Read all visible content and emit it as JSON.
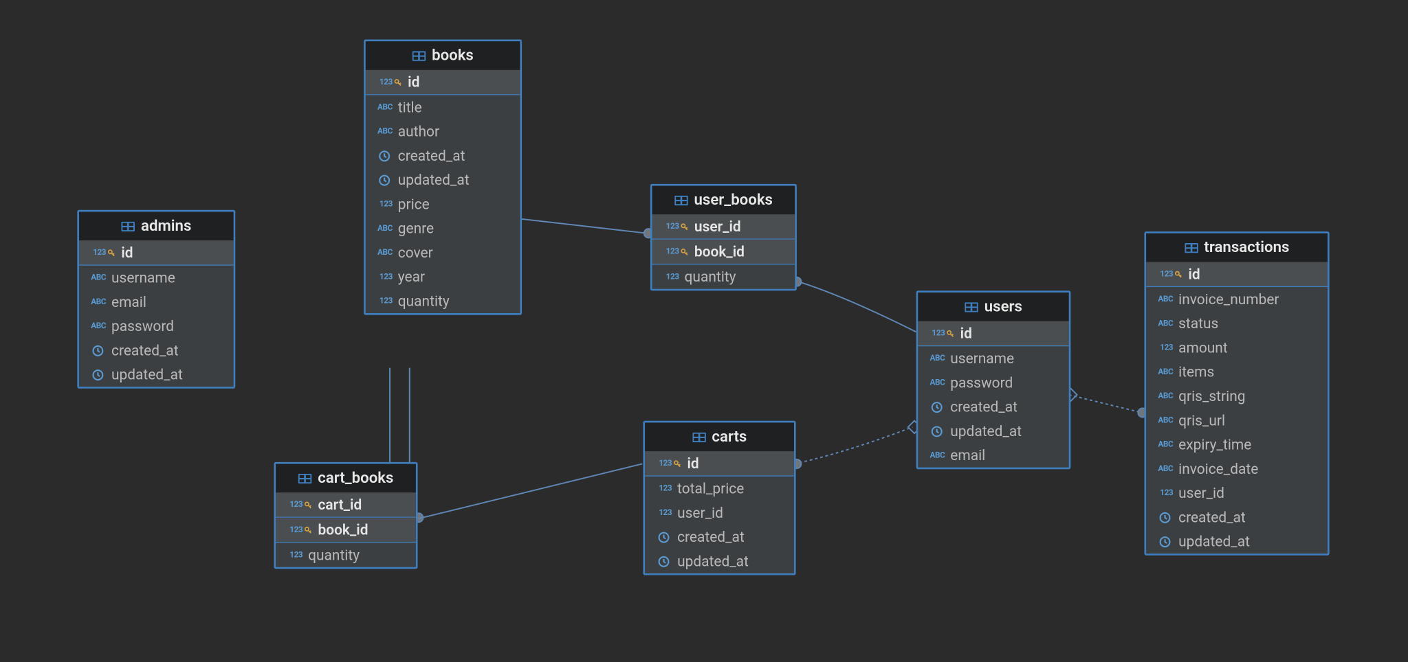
{
  "tables": {
    "admins": {
      "title": "admins",
      "columns": [
        {
          "name": "id",
          "type": "123",
          "pk": true
        },
        {
          "name": "username",
          "type": "ABC"
        },
        {
          "name": "email",
          "type": "ABC"
        },
        {
          "name": "password",
          "type": "ABC"
        },
        {
          "name": "created_at",
          "type": "clock"
        },
        {
          "name": "updated_at",
          "type": "clock"
        }
      ]
    },
    "books": {
      "title": "books",
      "columns": [
        {
          "name": "id",
          "type": "123",
          "pk": true
        },
        {
          "name": "title",
          "type": "ABC"
        },
        {
          "name": "author",
          "type": "ABC"
        },
        {
          "name": "created_at",
          "type": "clock"
        },
        {
          "name": "updated_at",
          "type": "clock"
        },
        {
          "name": "price",
          "type": "123"
        },
        {
          "name": "genre",
          "type": "ABC"
        },
        {
          "name": "cover",
          "type": "ABC"
        },
        {
          "name": "year",
          "type": "123"
        },
        {
          "name": "quantity",
          "type": "123"
        }
      ]
    },
    "user_books": {
      "title": "user_books",
      "columns": [
        {
          "name": "user_id",
          "type": "123",
          "pk": true
        },
        {
          "name": "book_id",
          "type": "123",
          "pk": true
        },
        {
          "name": "quantity",
          "type": "123"
        }
      ]
    },
    "users": {
      "title": "users",
      "columns": [
        {
          "name": "id",
          "type": "123",
          "pk": true
        },
        {
          "name": "username",
          "type": "ABC"
        },
        {
          "name": "password",
          "type": "ABC"
        },
        {
          "name": "created_at",
          "type": "clock"
        },
        {
          "name": "updated_at",
          "type": "clock"
        },
        {
          "name": "email",
          "type": "ABC"
        }
      ]
    },
    "carts": {
      "title": "carts",
      "columns": [
        {
          "name": "id",
          "type": "123",
          "pk": true
        },
        {
          "name": "total_price",
          "type": "123"
        },
        {
          "name": "user_id",
          "type": "123"
        },
        {
          "name": "created_at",
          "type": "clock"
        },
        {
          "name": "updated_at",
          "type": "clock"
        }
      ]
    },
    "cart_books": {
      "title": "cart_books",
      "columns": [
        {
          "name": "cart_id",
          "type": "123",
          "pk": true
        },
        {
          "name": "book_id",
          "type": "123",
          "pk": true
        },
        {
          "name": "quantity",
          "type": "123"
        }
      ]
    },
    "transactions": {
      "title": "transactions",
      "columns": [
        {
          "name": "id",
          "type": "123",
          "pk": true
        },
        {
          "name": "invoice_number",
          "type": "ABC"
        },
        {
          "name": "status",
          "type": "ABC"
        },
        {
          "name": "amount",
          "type": "123"
        },
        {
          "name": "items",
          "type": "ABC"
        },
        {
          "name": "qris_string",
          "type": "ABC"
        },
        {
          "name": "qris_url",
          "type": "ABC"
        },
        {
          "name": "expiry_time",
          "type": "ABC"
        },
        {
          "name": "invoice_date",
          "type": "ABC"
        },
        {
          "name": "user_id",
          "type": "123"
        },
        {
          "name": "created_at",
          "type": "clock"
        },
        {
          "name": "updated_at",
          "type": "clock"
        }
      ]
    }
  }
}
